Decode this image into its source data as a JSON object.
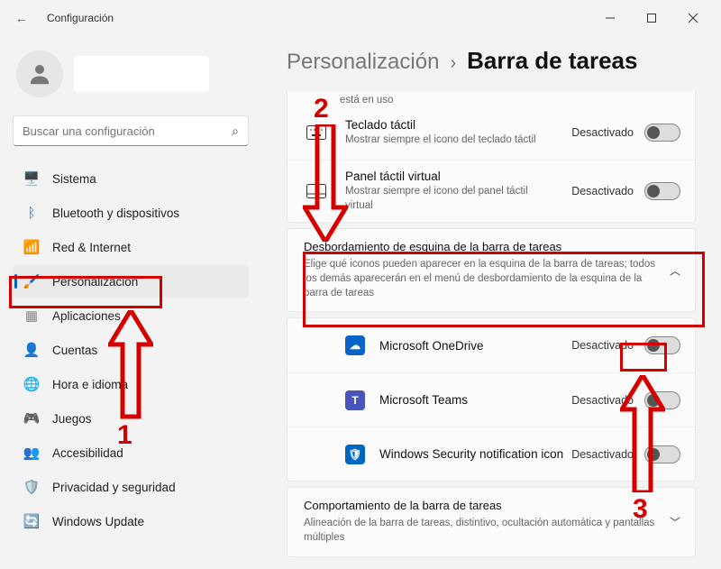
{
  "window": {
    "title": "Configuración"
  },
  "search": {
    "placeholder": "Buscar una configuración"
  },
  "nav": {
    "items": [
      {
        "icon": "🖥️",
        "label": "Sistema"
      },
      {
        "icon": "ᛒ",
        "label": "Bluetooth y dispositivos",
        "iconColor": "#0a7cd8"
      },
      {
        "icon": "📶",
        "label": "Red & Internet",
        "iconColor": "#1aa0e0"
      },
      {
        "icon": "🖌️",
        "label": "Personalización"
      },
      {
        "icon": "▦",
        "label": "Aplicaciones",
        "iconColor": "#888"
      },
      {
        "icon": "👤",
        "label": "Cuentas"
      },
      {
        "icon": "🌐",
        "label": "Hora e idioma"
      },
      {
        "icon": "🎮",
        "label": "Juegos"
      },
      {
        "icon": "👥",
        "label": "Accesibilidad"
      },
      {
        "icon": "🛡️",
        "label": "Privacidad y seguridad"
      },
      {
        "icon": "🔄",
        "label": "Windows Update"
      }
    ],
    "activeIndex": 3
  },
  "breadcrumb": {
    "parent": "Personalización",
    "sep": "›",
    "current": "Barra de tareas"
  },
  "partialTop": {
    "stub": "está en uso",
    "rows": [
      {
        "title": "Teclado táctil",
        "desc": "Mostrar siempre el icono del teclado táctil",
        "state": "Desactivado",
        "icon": "keyboard"
      },
      {
        "title": "Panel táctil virtual",
        "desc": "Mostrar siempre el icono del panel táctil virtual",
        "state": "Desactivado",
        "icon": "touchpad"
      }
    ]
  },
  "overflowSection": {
    "title": "Desbordamiento de esquina de la barra de tareas",
    "desc": "Elige qué iconos pueden aparecer en la esquina de la barra de tareas; todos los demás aparecerán en el menú de desbordamiento de la esquina de la barra de tareas",
    "rows": [
      {
        "title": "Microsoft OneDrive",
        "state": "Desactivado",
        "bg": "#0a63c9",
        "glyph": "☁"
      },
      {
        "title": "Microsoft Teams",
        "state": "Desactivado",
        "bg": "#4b53bc",
        "glyph": "T"
      },
      {
        "title": "Windows Security notification icon",
        "state": "Desactivado",
        "bg": "#0067c0",
        "glyph": "🛡"
      }
    ]
  },
  "behaviorSection": {
    "title": "Comportamiento de la barra de tareas",
    "desc": "Alineación de la barra de tareas, distintivo, ocultación automática y pantallas múltiples"
  },
  "annotations": {
    "n1": "1",
    "n2": "2",
    "n3": "3"
  }
}
